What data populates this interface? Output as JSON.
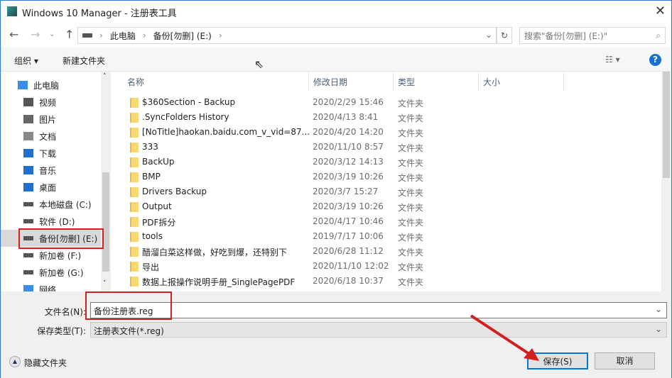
{
  "window": {
    "title": "Windows 10 Manager - 注册表工具",
    "close": "✕"
  },
  "address": {
    "crumbs": [
      "此电脑",
      "备份[勿删] (E:)"
    ],
    "search_placeholder": "搜索\"备份[勿删] (E:)\""
  },
  "toolbar": {
    "organize": "组织",
    "new_folder": "新建文件夹",
    "help": "?"
  },
  "sidebar": {
    "items": [
      {
        "label": "此电脑",
        "icon": "computer"
      },
      {
        "label": "视频",
        "icon": "video"
      },
      {
        "label": "图片",
        "icon": "picture"
      },
      {
        "label": "文档",
        "icon": "document"
      },
      {
        "label": "下载",
        "icon": "download"
      },
      {
        "label": "音乐",
        "icon": "music"
      },
      {
        "label": "桌面",
        "icon": "desktop"
      },
      {
        "label": "本地磁盘 (C:)",
        "icon": "drive"
      },
      {
        "label": "软件 (D:)",
        "icon": "drive"
      },
      {
        "label": "备份[勿删] (E:)",
        "icon": "drive"
      },
      {
        "label": "新加卷 (F:)",
        "icon": "drive"
      },
      {
        "label": "新加卷 (G:)",
        "icon": "drive"
      },
      {
        "label": "网络",
        "icon": "network"
      }
    ]
  },
  "columns": [
    "名称",
    "修改日期",
    "类型",
    "大小"
  ],
  "files": [
    {
      "name": "$360Section - Backup",
      "date": "2020/2/29 15:46",
      "type": "文件夹"
    },
    {
      "name": ".SyncFolders History",
      "date": "2020/4/13 8:41",
      "type": "文件夹"
    },
    {
      "name": "[NoTitle]haokan.baidu.com_v_vid=87...",
      "date": "2020/4/20 14:20",
      "type": "文件夹"
    },
    {
      "name": "333",
      "date": "2020/11/10 8:57",
      "type": "文件夹"
    },
    {
      "name": "BackUp",
      "date": "2020/3/12 14:13",
      "type": "文件夹"
    },
    {
      "name": "BMP",
      "date": "2020/3/19 10:26",
      "type": "文件夹"
    },
    {
      "name": "Drivers Backup",
      "date": "2020/3/7 15:27",
      "type": "文件夹"
    },
    {
      "name": "Output",
      "date": "2020/3/19 10:26",
      "type": "文件夹"
    },
    {
      "name": "PDF拆分",
      "date": "2020/4/17 10:46",
      "type": "文件夹"
    },
    {
      "name": "tools",
      "date": "2019/7/17 10:06",
      "type": "文件夹"
    },
    {
      "name": "醋溜白菜这样做，好吃到爆，还特别下",
      "date": "2020/6/28 11:12",
      "type": "文件夹"
    },
    {
      "name": "导出",
      "date": "2020/11/10 12:02",
      "type": "文件夹"
    },
    {
      "name": "数据上报操作说明手册_SinglePagePDF",
      "date": "2020/6/18 10:37",
      "type": "文件夹"
    }
  ],
  "form": {
    "filename_label": "文件名(N):",
    "filename_value": "备份注册表.reg",
    "type_label": "保存类型(T):",
    "type_value": "注册表文件(*.reg)"
  },
  "footer": {
    "hide_folders": "隐藏文件夹",
    "save": "保存(S)",
    "cancel": "取消"
  },
  "colors": {
    "accent": "#0078d7",
    "annotation": "#d21f1f"
  }
}
